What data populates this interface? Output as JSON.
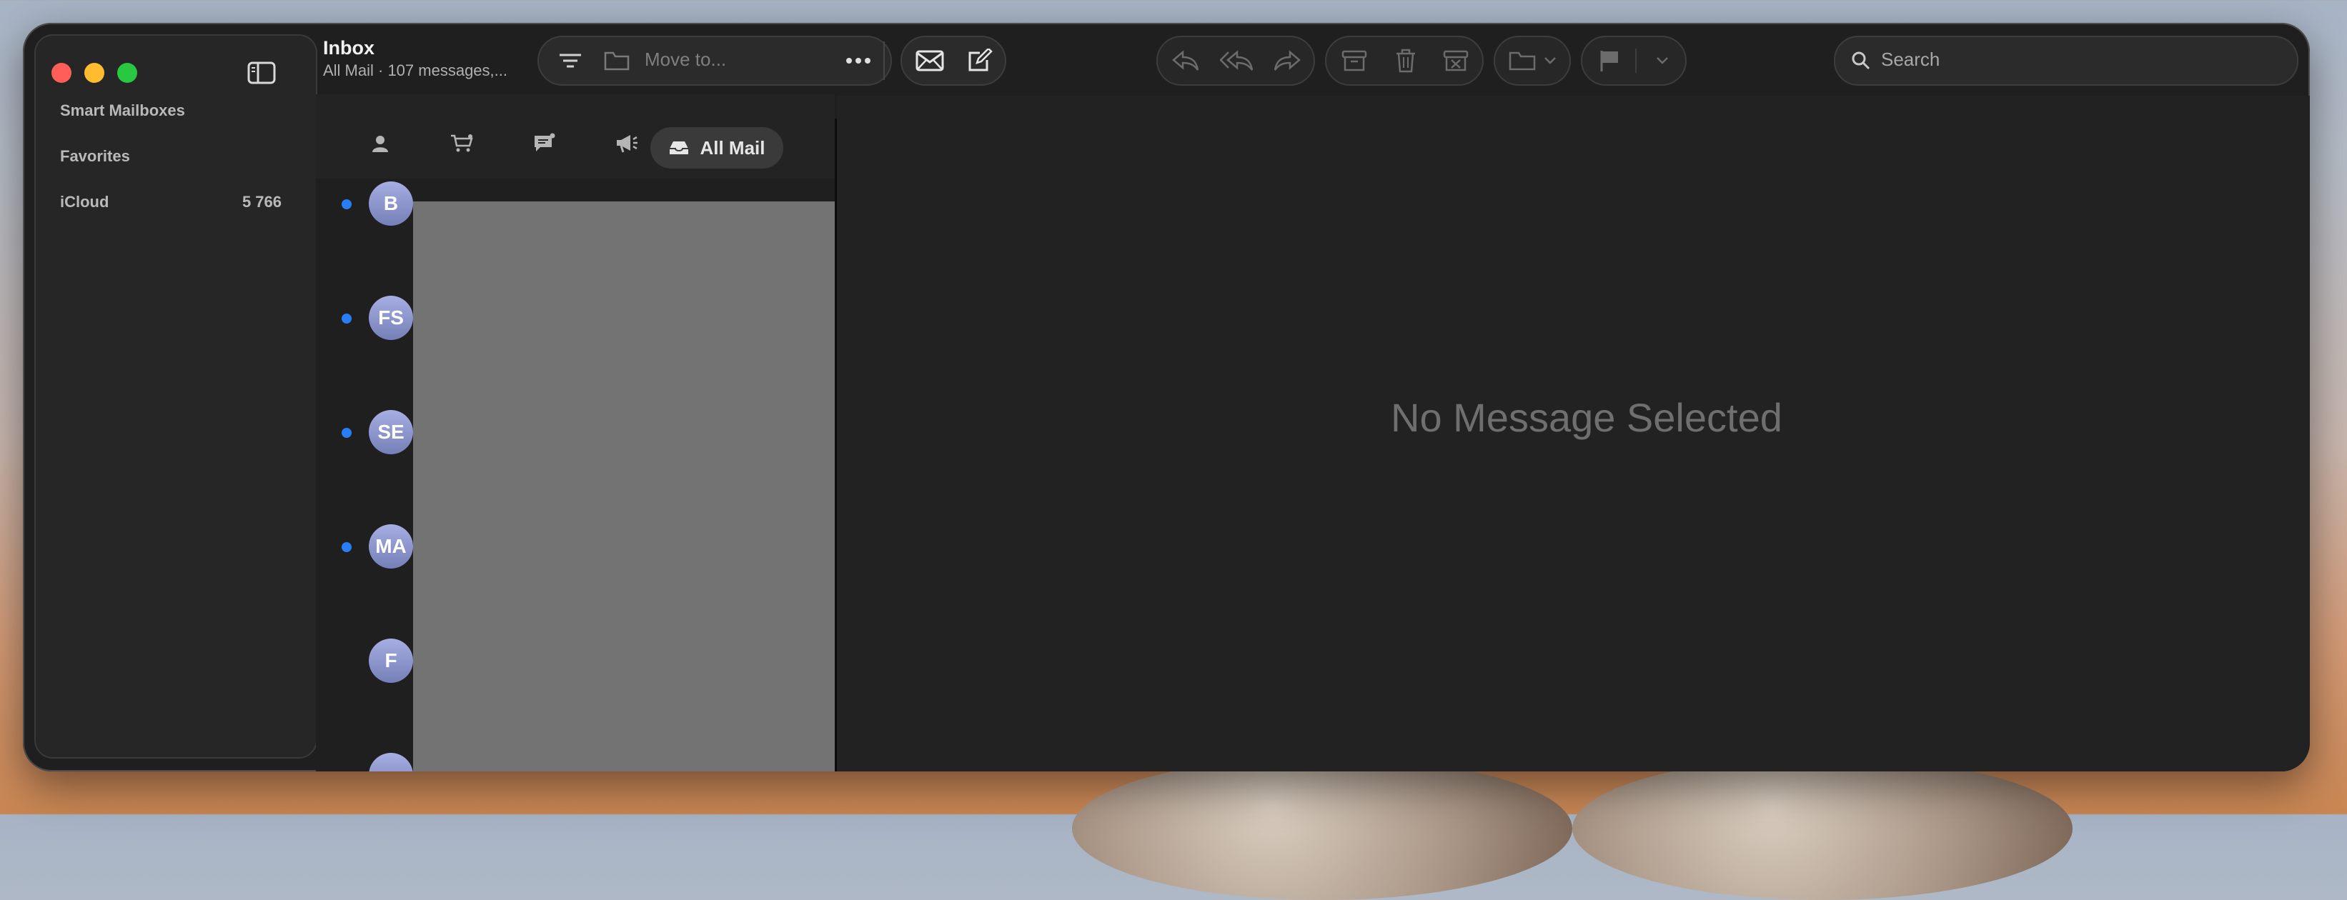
{
  "window": {
    "title": "Inbox",
    "subtitle": "All Mail · 107 messages,..."
  },
  "sidebar": {
    "items": [
      {
        "label": "Smart Mailboxes"
      },
      {
        "label": "Favorites"
      },
      {
        "label": "iCloud",
        "count": "5 766"
      }
    ]
  },
  "toolbar": {
    "move_to_placeholder": "Move to...",
    "search_placeholder": "Search"
  },
  "filters": {
    "all_mail_label": "All Mail"
  },
  "messages": [
    {
      "initials": "B",
      "unread": true
    },
    {
      "initials": "FS",
      "unread": true
    },
    {
      "initials": "SE",
      "unread": true
    },
    {
      "initials": "MA",
      "unread": true
    },
    {
      "initials": "F",
      "unread": false
    }
  ],
  "viewer": {
    "empty_text": "No Message Selected"
  },
  "colors": {
    "unread_dot": "#2a7ef5",
    "close": "#ff5f57",
    "minimize": "#febc2e",
    "maximize": "#28c840"
  }
}
